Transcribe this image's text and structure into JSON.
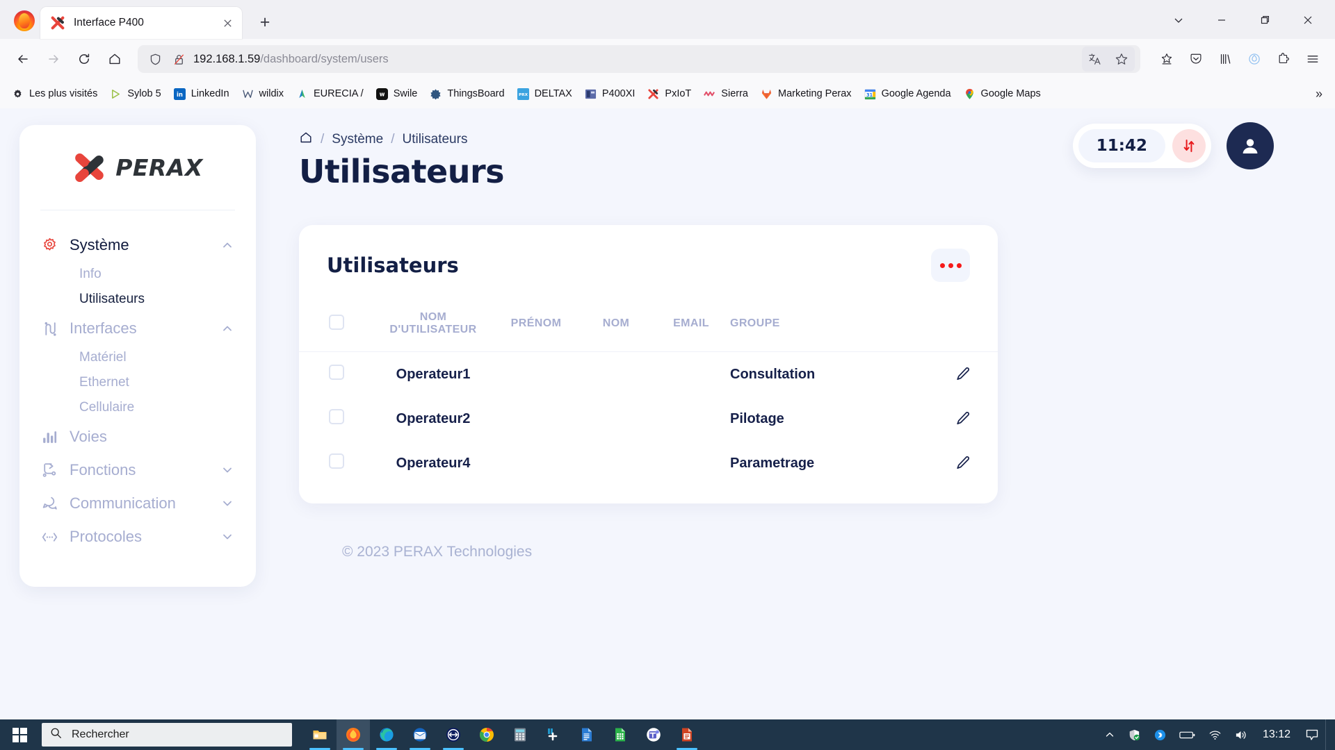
{
  "browser": {
    "tab": {
      "title": "Interface P400",
      "favicon_icon": "perax-x-icon",
      "close_icon": "close-icon"
    },
    "newtab_icon": "plus-icon",
    "window_controls": {
      "list_icon": "chevron-down-icon",
      "minimize": "minimize-icon",
      "maximize": "maximize-icon",
      "close": "close-icon"
    },
    "nav": {
      "back_icon": "arrow-left-icon",
      "forward_icon": "arrow-right-icon",
      "reload_icon": "reload-icon",
      "home_icon": "home-icon"
    },
    "url": {
      "shield_icon": "shield-icon",
      "lock_icon": "lock-crossed-icon",
      "host": "192.168.1.59",
      "path": "/dashboard/system/users",
      "translate_icon": "translate-icon",
      "bookmark_icon": "star-icon"
    },
    "toolbar_icons": [
      "save-to-pocket-star-icon",
      "pocket-icon",
      "library-icon",
      "firefox-view-icon",
      "extensions-icon",
      "hamburger-menu-icon"
    ],
    "bookmarks": [
      {
        "label": "Les plus visités",
        "icon": "star-gear-icon"
      },
      {
        "label": "Sylob 5",
        "icon": "sylob-icon"
      },
      {
        "label": "LinkedIn",
        "icon": "linkedin-icon"
      },
      {
        "label": "wildix",
        "icon": "wildix-icon"
      },
      {
        "label": "EURECIA /",
        "icon": "eurecia-icon"
      },
      {
        "label": "Swile",
        "icon": "swile-icon"
      },
      {
        "label": "ThingsBoard",
        "icon": "thingsboard-icon"
      },
      {
        "label": "DELTAX",
        "icon": "deltax-icon"
      },
      {
        "label": "P400XI",
        "icon": "p400xi-icon"
      },
      {
        "label": "PxIoT",
        "icon": "pxiot-icon"
      },
      {
        "label": "Sierra",
        "icon": "sierra-icon"
      },
      {
        "label": "Marketing Perax",
        "icon": "gitlab-icon"
      },
      {
        "label": "Google Agenda",
        "icon": "google-calendar-icon"
      },
      {
        "label": "Google Maps",
        "icon": "google-maps-icon"
      }
    ],
    "bookmarks_overflow_icon": "chevron-double-right-icon"
  },
  "sidebar": {
    "brand": {
      "text": "PERAX",
      "logo_icon": "perax-x-logo-icon"
    },
    "items": [
      {
        "label": "Système",
        "icon": "gear-icon",
        "expanded": true,
        "active": true,
        "children": [
          {
            "label": "Info",
            "active": false
          },
          {
            "label": "Utilisateurs",
            "active": true
          }
        ]
      },
      {
        "label": "Interfaces",
        "icon": "interfaces-icon",
        "expanded": true,
        "active": false,
        "children": [
          {
            "label": "Matériel",
            "active": false
          },
          {
            "label": "Ethernet",
            "active": false
          },
          {
            "label": "Cellulaire",
            "active": false
          }
        ]
      },
      {
        "label": "Voies",
        "icon": "bar-chart-icon",
        "expanded": null,
        "active": false,
        "children": []
      },
      {
        "label": "Fonctions",
        "icon": "functions-icon",
        "expanded": false,
        "active": false,
        "children": []
      },
      {
        "label": "Communication",
        "icon": "chat-bubble-icon",
        "expanded": false,
        "active": false,
        "children": []
      },
      {
        "label": "Protocoles",
        "icon": "protocols-icon",
        "expanded": false,
        "active": false,
        "children": []
      }
    ]
  },
  "header": {
    "breadcrumb": {
      "home_icon": "home-icon",
      "sep": "/",
      "items": [
        "Système",
        "Utilisateurs"
      ]
    },
    "page_title": "Utilisateurs",
    "clock": "11:42",
    "sync_icon": "sync-arrows-icon",
    "avatar_icon": "user-avatar-icon"
  },
  "card": {
    "title": "Utilisateurs",
    "menu_icon": "more-dots-icon",
    "columns": [
      "",
      "NOM D'UTILISATEUR",
      "PRÉNOM",
      "NOM",
      "EMAIL",
      "GROUPE",
      ""
    ],
    "rows": [
      {
        "username": "Operateur1",
        "prenom": "",
        "nom": "",
        "email": "",
        "groupe": "Consultation",
        "edit_icon": "pencil-icon"
      },
      {
        "username": "Operateur2",
        "prenom": "",
        "nom": "",
        "email": "",
        "groupe": "Pilotage",
        "edit_icon": "pencil-icon"
      },
      {
        "username": "Operateur4",
        "prenom": "",
        "nom": "",
        "email": "",
        "groupe": "Parametrage",
        "edit_icon": "pencil-icon"
      }
    ]
  },
  "footer": {
    "text": "© 2023 PERAX Technologies"
  },
  "taskbar": {
    "start_icon": "windows-start-icon",
    "search_placeholder": "Rechercher",
    "search_icon": "search-icon",
    "apps": [
      {
        "icon": "file-explorer-icon",
        "active": false,
        "running": true
      },
      {
        "icon": "firefox-icon",
        "active": true,
        "running": true
      },
      {
        "icon": "microsoft-edge-icon",
        "active": false,
        "running": true
      },
      {
        "icon": "outlook-icon",
        "active": false,
        "running": true
      },
      {
        "icon": "teamviewer-icon",
        "active": false,
        "running": true
      },
      {
        "icon": "chrome-icon",
        "active": false,
        "running": false
      },
      {
        "icon": "calculator-icon",
        "active": false,
        "running": false
      },
      {
        "icon": "notepadpp-icon",
        "active": false,
        "running": false
      },
      {
        "icon": "word-icon",
        "active": false,
        "running": false
      },
      {
        "icon": "excel-icon",
        "active": false,
        "running": false
      },
      {
        "icon": "ms-teams-icon",
        "active": false,
        "running": false
      },
      {
        "icon": "powerpoint-icon",
        "active": false,
        "running": true
      }
    ],
    "tray": [
      "chevron-up-icon",
      "windows-defender-icon",
      "bluetooth-icon",
      "battery-icon",
      "wifi-icon",
      "volume-icon"
    ],
    "clock": "13:12",
    "notifications_icon": "notification-icon"
  },
  "colors": {
    "accent_red": "#e8453c",
    "navy": "#131f45",
    "muted": "#a6add0",
    "page_bg": "#f4f6fd"
  }
}
